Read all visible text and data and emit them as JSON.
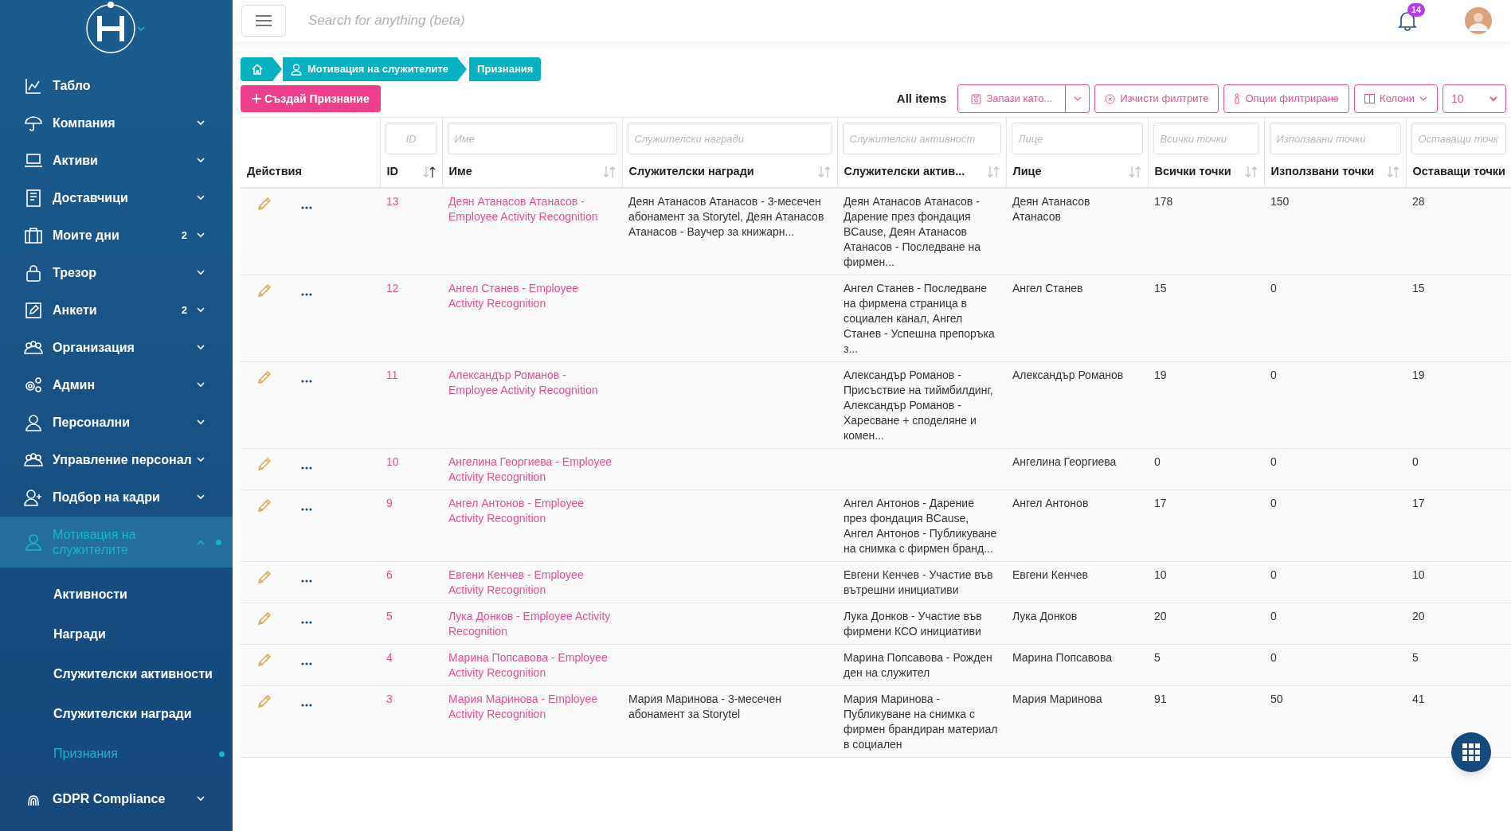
{
  "sidebar": {
    "items": [
      {
        "kind": "link",
        "label": "Табло",
        "selected": false
      },
      {
        "kind": "group",
        "label": "Компания",
        "expanded": false,
        "selected": false
      },
      {
        "kind": "group",
        "label": "Активи",
        "expanded": false,
        "selected": false
      },
      {
        "kind": "group",
        "label": "Доставчици",
        "expanded": false,
        "selected": false
      },
      {
        "kind": "group",
        "label": "Моите дни",
        "badge": "2",
        "expanded": false,
        "selected": false
      },
      {
        "kind": "group",
        "label": "Трезор",
        "expanded": false,
        "selected": false
      },
      {
        "kind": "group",
        "label": "Анкети",
        "badge": "2",
        "expanded": false,
        "selected": false
      },
      {
        "kind": "group",
        "label": "Организация",
        "expanded": false,
        "selected": false
      },
      {
        "kind": "group",
        "label": "Админ",
        "expanded": false,
        "selected": false
      },
      {
        "kind": "group",
        "label": "Персонални",
        "expanded": false,
        "selected": false
      },
      {
        "kind": "group",
        "label": "Управление персонал",
        "expanded": false,
        "selected": false
      },
      {
        "kind": "group",
        "label": "Подбор на кадри",
        "expanded": false,
        "selected": false
      },
      {
        "kind": "group",
        "label": "Мотивация на служителите",
        "expanded": true,
        "selected": true,
        "children": [
          {
            "label": "Активности",
            "selected": false
          },
          {
            "label": "Награди",
            "selected": false
          },
          {
            "label": "Служителски активности",
            "selected": false
          },
          {
            "label": "Служителски награди",
            "selected": false
          },
          {
            "label": "Признания",
            "selected": true
          }
        ]
      },
      {
        "kind": "group",
        "label": "GDPR Compliance",
        "expanded": false,
        "selected": false
      }
    ]
  },
  "header": {
    "search": {
      "placeholder": "Search for anything (beta)"
    },
    "notifications": {
      "count": "14"
    }
  },
  "breadcrumb": [
    {
      "kind": "home"
    },
    {
      "kind": "section",
      "label": "Мотивация на служителите"
    },
    {
      "kind": "page",
      "label": "Признания"
    }
  ],
  "toolbar": {
    "create_button": {
      "label": "Създай Признание"
    },
    "view_label": "All items",
    "buttons": [
      {
        "kind": "save",
        "label": "Запази като..."
      },
      {
        "kind": "caret"
      },
      {
        "kind": "clear",
        "label": "Изчисти филтрите"
      },
      {
        "kind": "filter",
        "label": "Опции филтриране"
      },
      {
        "kind": "columns",
        "label": "Колони"
      }
    ],
    "page_size": "10"
  },
  "table": {
    "columns": [
      {
        "label": "Действия"
      },
      {
        "label": "ID",
        "placeholder": "ID",
        "sorted": true
      },
      {
        "label": "Име",
        "placeholder": "Име",
        "sorted": false
      },
      {
        "label": "Служителски награди",
        "placeholder": "Служителски награди",
        "sorted": false
      },
      {
        "label": "Служителски актив...",
        "placeholder": "Служителски активност",
        "sorted": false
      },
      {
        "label": "Лице",
        "placeholder": "Лице",
        "sorted": false
      },
      {
        "label": "Всички точки",
        "placeholder": "Всички точки",
        "sorted": false
      },
      {
        "label": "Използвани точки",
        "placeholder": "Използвани точки",
        "sorted": false
      },
      {
        "label": "Оставащи точки",
        "placeholder": "Оставащи точк"
      }
    ],
    "rows": [
      {
        "id": "13",
        "name": "Деян Атанасов Атанасов - Employee Activity Recognition",
        "awards": "Деян Атанасов Атанасов - 3-месечен абонамент за Storytel, Деян Атанасов Атанасов - Ваучер за книжарн...",
        "activities": "Деян Атанасов Атанасов - Дарение през фондация BCause, Деян Атанасов Атанасов - Последване на фирмен...",
        "person": "Деян Атанасов Атанасов",
        "total": "178",
        "used": "150",
        "remaining": "28"
      },
      {
        "id": "12",
        "name": "Ангел Станев - Employee Activity Recognition",
        "activities": "Ангел Станев - Последване на фирмена страница в социален канал, Ангел Станев - Успешна препоръка з...",
        "person": "Ангел Станев",
        "total": "15",
        "used": "0",
        "remaining": "15"
      },
      {
        "id": "11",
        "name": "Александър Романов - Employee Activity Recognition",
        "activities": "Александър Романов - Присъствие на тиймбилдинг, Александър Романов - Харесване + споделяне и комен...",
        "person": "Александър Романов",
        "total": "19",
        "used": "0",
        "remaining": "19"
      },
      {
        "id": "10",
        "name": "Ангелина Георгиева - Employee Activity Recognition",
        "person": "Ангелина Георгиева",
        "total": "0",
        "used": "0",
        "remaining": "0"
      },
      {
        "id": "9",
        "name": "Ангел Антонов - Employee Activity Recognition",
        "activities": "Ангел Антонов - Дарение през фондация BCause, Ангел Антонов - Публикуване на снимка с фирмен бранд...",
        "person": "Ангел Антонов",
        "total": "17",
        "used": "0",
        "remaining": "17"
      },
      {
        "id": "6",
        "name": "Евгени Кенчев - Employee Activity Recognition",
        "activities": "Евгени Кенчев - Участие във вътрешни инициативи",
        "person": "Евгени Кенчев",
        "total": "10",
        "used": "0",
        "remaining": "10"
      },
      {
        "id": "5",
        "name": "Лука Донков - Employee Activity Recognition",
        "activities": "Лука Донков - Участие във фирмени КСО инициативи",
        "person": "Лука Донков",
        "total": "20",
        "used": "0",
        "remaining": "20"
      },
      {
        "id": "4",
        "name": "Марина Попсавова - Employee Activity Recognition",
        "activities": "Марина Попсавова - Рожден ден на служител",
        "person": "Марина Попсавова",
        "total": "5",
        "used": "0",
        "remaining": "5"
      },
      {
        "id": "3",
        "name": "Мария Маринова - Employee Activity Recognition",
        "awards": "Мария Маринова - 3-месечен абонамент за Storytel",
        "activities": "Мария Маринова - Публикуване на снимка с фирмен брандиран материал в социален",
        "person": "Мария Маринова",
        "total": "91",
        "used": "50",
        "remaining": "41"
      }
    ]
  }
}
